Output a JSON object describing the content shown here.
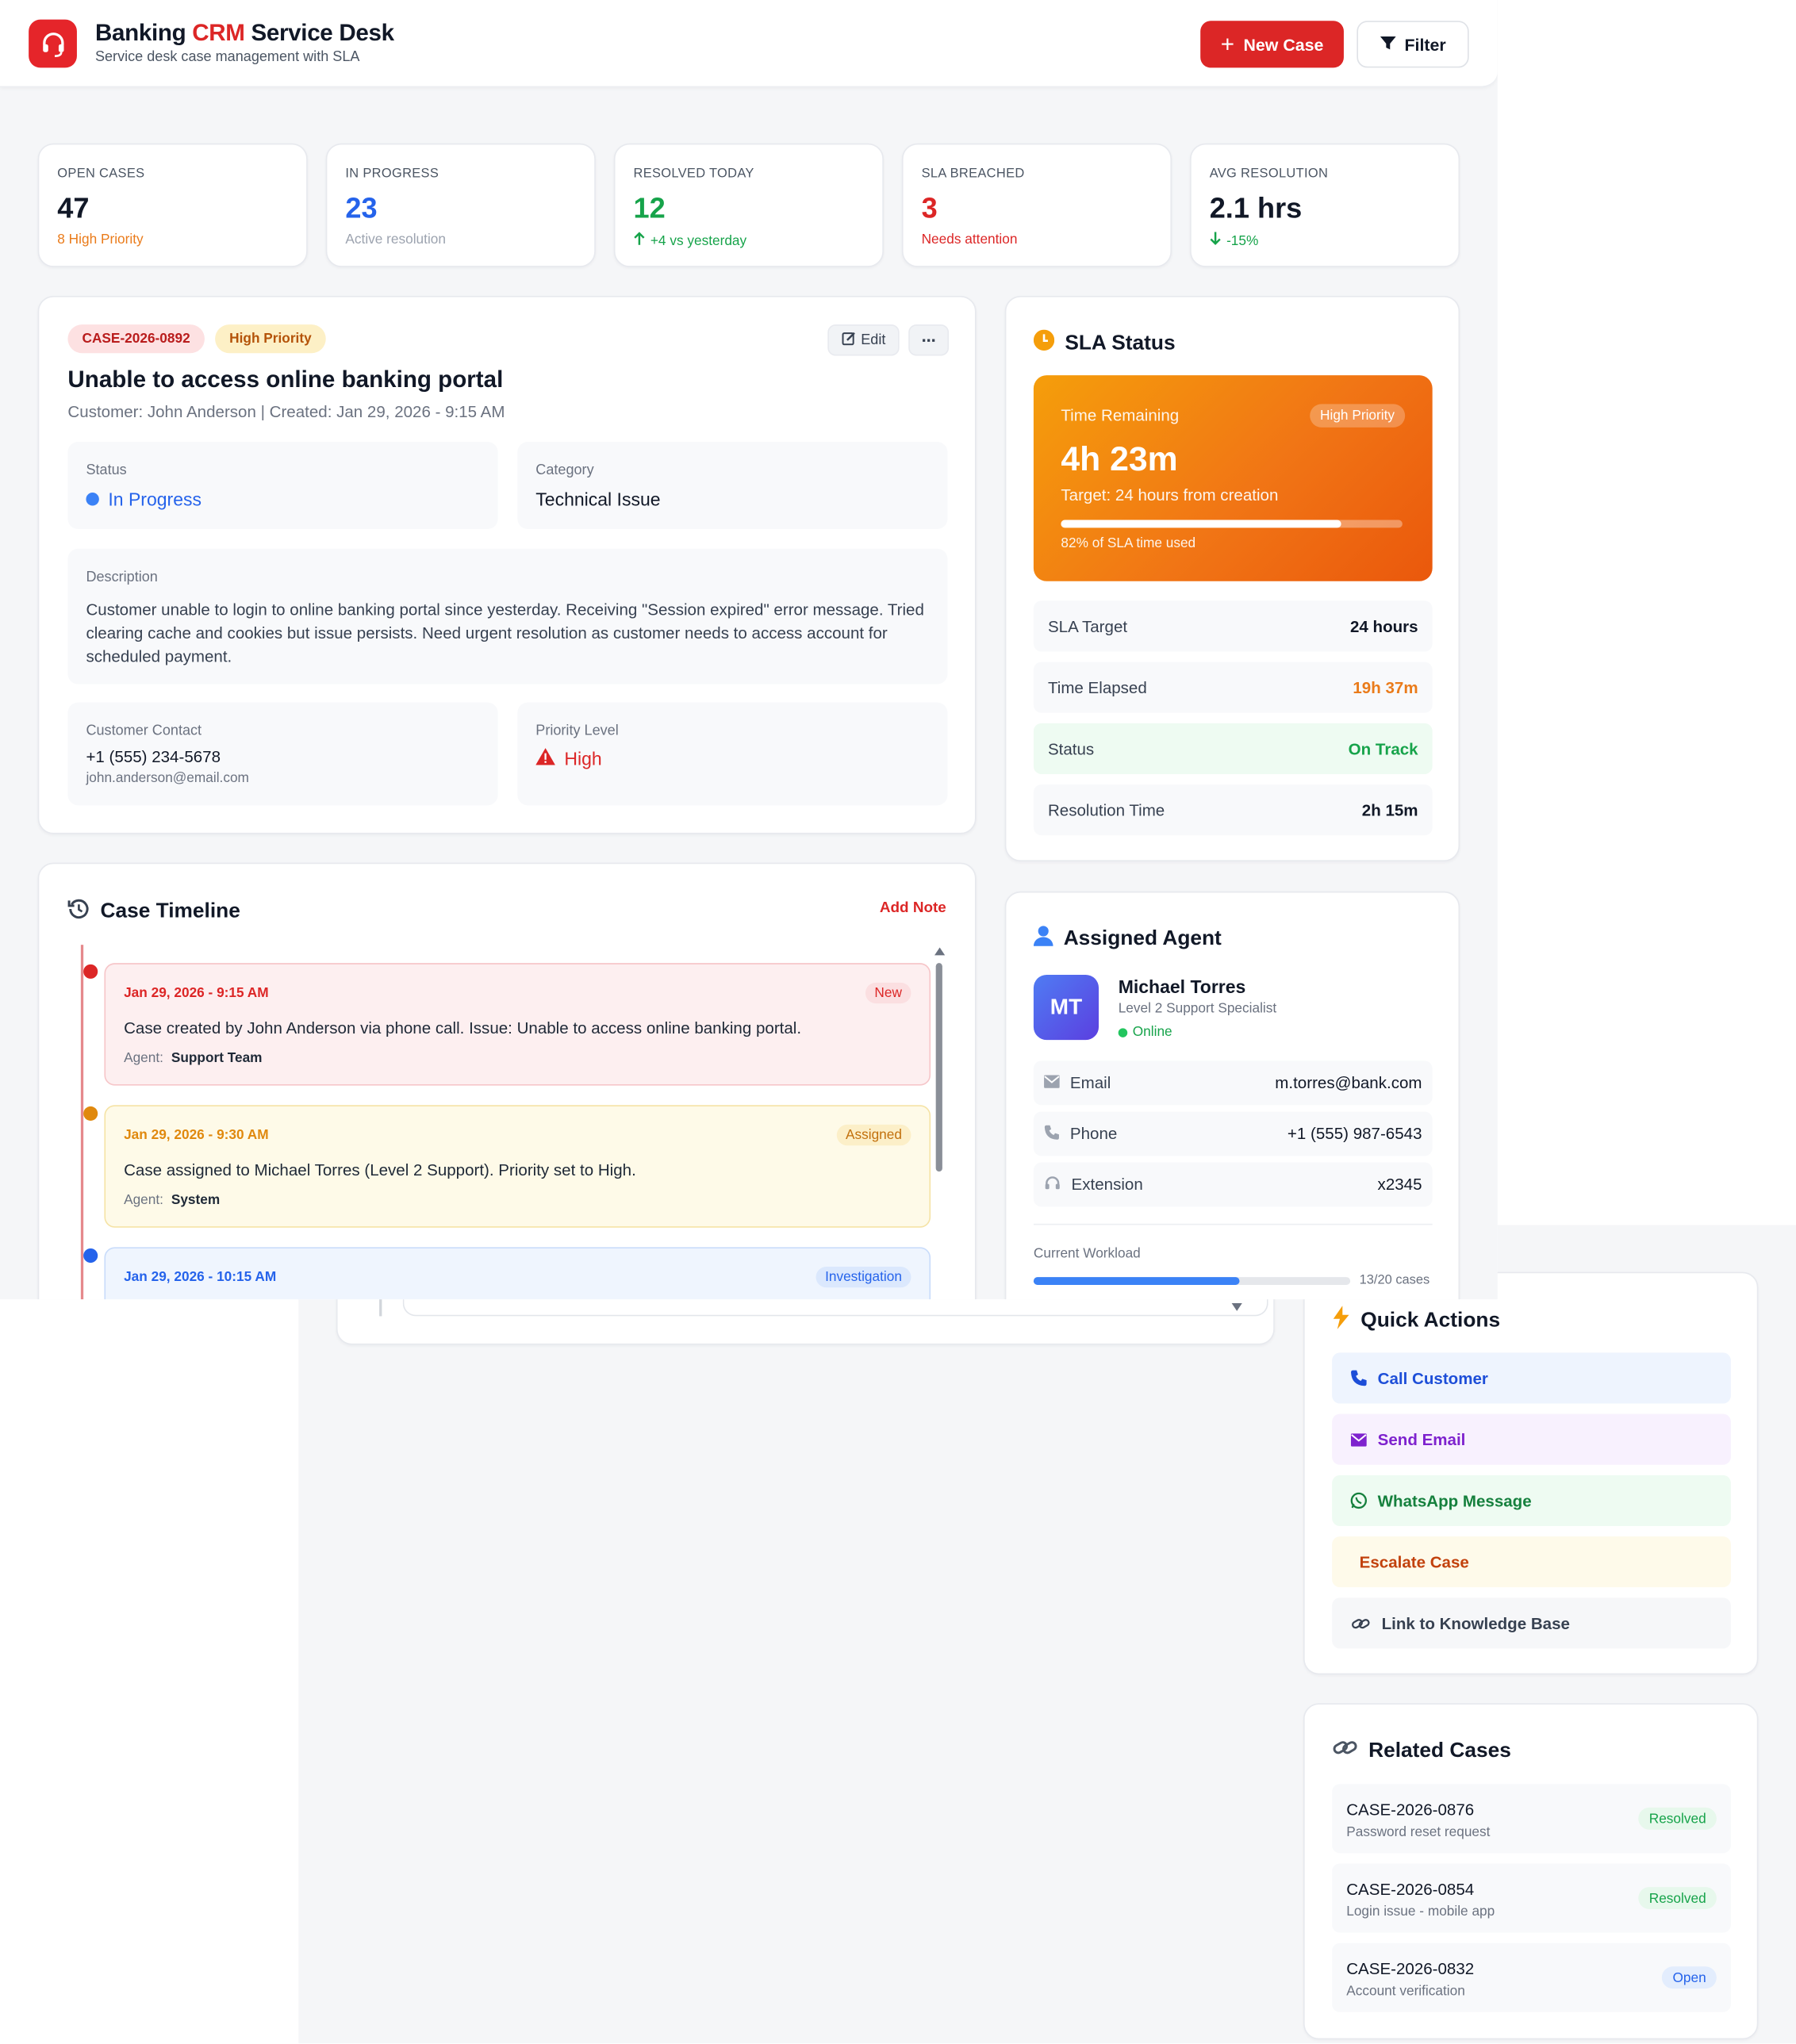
{
  "header": {
    "title_pre": "Banking ",
    "title_accent": "CRM",
    "title_post": " Service Desk",
    "subtitle": "Service desk case management with SLA",
    "new_case_label": "New Case",
    "filter_label": "Filter"
  },
  "kpis": [
    {
      "label": "Open Cases",
      "value": "47",
      "sub": "8 High Priority",
      "value_color": "#111827",
      "sub_color": "#ea7b1a"
    },
    {
      "label": "In Progress",
      "value": "23",
      "sub": "Active resolution",
      "value_color": "#2563eb",
      "sub_color": "#9ca3af"
    },
    {
      "label": "Resolved Today",
      "value": "12",
      "sub": "+4 vs yesterday",
      "value_color": "#16a34a",
      "sub_color": "#16a34a"
    },
    {
      "label": "SLA Breached",
      "value": "3",
      "sub": "Needs attention",
      "value_color": "#dc2626",
      "sub_color": "#dc2626"
    },
    {
      "label": "Avg Resolution",
      "value": "2.1 hrs",
      "sub": "-15%",
      "value_color": "#111827",
      "sub_color": "#16a34a"
    }
  ],
  "case": {
    "id": "CASE-2026-0892",
    "priority_badge": "High Priority",
    "edit_label": "Edit",
    "more_label": "⋯",
    "title": "Unable to access online banking portal",
    "meta": "Customer: John Anderson | Created: Jan 29, 2026 - 9:15 AM",
    "status_label": "Status",
    "status_value": "In Progress",
    "category_label": "Category",
    "category_value": "Technical Issue",
    "description_label": "Description",
    "description_line1": "Customer unable to login to online banking portal since yesterday. Receiving \"Session expired\" error message. Tried",
    "description_line2": "clearing cache and cookies but issue persists. Need urgent resolution as customer needs to access account for",
    "description_line3": "scheduled payment.",
    "contact_label": "Customer Contact",
    "contact_phone": "+1 (555) 234-5678",
    "contact_email": "john.anderson@email.com",
    "priority_label": "Priority Level",
    "priority_value": "High"
  },
  "sla": {
    "title": "SLA Status",
    "time_remaining_label": "Time Remaining",
    "priority_badge": "High Priority",
    "time_remaining": "4h 23m",
    "target_text": "Target: 24 hours from creation",
    "used_fraction": 0.82,
    "used_text": "82% of SLA time used",
    "rows": [
      {
        "label": "SLA Target",
        "value": "24 hours",
        "color": "#111827",
        "bg": "#f8f9fb"
      },
      {
        "label": "Time Elapsed",
        "value": "19h 37m",
        "color": "#ea7b1a",
        "bg": "#f8f9fb"
      },
      {
        "label": "Status",
        "value": "On Track",
        "color": "#16a34a",
        "bg": "#eefbf2"
      },
      {
        "label": "Resolution Time",
        "value": "2h 15m",
        "color": "#111827",
        "bg": "#f8f9fb"
      }
    ]
  },
  "timeline": {
    "title": "Case Timeline",
    "add_note_label": "Add Note",
    "agent_label": "Agent:",
    "items": [
      {
        "date": "Jan 29, 2026 - 9:15 AM",
        "tag": "New",
        "text": "Case created by John Anderson via phone call. Issue: Unable to access online banking portal.",
        "agent": "Support Team",
        "color": "#dc2626",
        "bg": "#fdeff0",
        "border": "#f6c6c9",
        "tag_bg": "#fbdfe1",
        "tag_color": "#dc2626"
      },
      {
        "date": "Jan 29, 2026 - 9:30 AM",
        "tag": "Assigned",
        "text": "Case assigned to Michael Torres (Level 2 Support). Priority set to High.",
        "agent": "System",
        "color": "#e0890e",
        "bg": "#fefae8",
        "border": "#f5e3a6",
        "tag_bg": "#fcefc8",
        "tag_color": "#c2700c"
      },
      {
        "date": "Jan 29, 2026 - 10:15 AM",
        "tag": "Investigation",
        "text": "",
        "agent": "",
        "color": "#2563eb",
        "bg": "#eff5fe",
        "border": "#c9dcfb",
        "tag_bg": "#dbe8fd",
        "tag_color": "#2563eb"
      }
    ]
  },
  "agent": {
    "title": "Assigned Agent",
    "initials": "MT",
    "name": "Michael Torres",
    "role": "Level 2 Support Specialist",
    "presence": "Online",
    "email_label": "Email",
    "email": "m.torres@bank.com",
    "phone_label": "Phone",
    "phone": "+1 (555) 987-6543",
    "ext_label": "Extension",
    "ext": "x2345",
    "workload_label": "Current Workload",
    "workload_fraction": 0.65,
    "workload_text": "13/20 cases"
  },
  "quick_actions": {
    "title": "Quick Actions",
    "items": [
      {
        "label": "Call Customer",
        "icon": "phone-icon",
        "color": "#1d4ed8",
        "bg": "#eef4fe"
      },
      {
        "label": "Send Email",
        "icon": "mail-icon",
        "color": "#7e22ce",
        "bg": "#f8f1fe"
      },
      {
        "label": "WhatsApp Message",
        "icon": "whatsapp-icon",
        "color": "#15803d",
        "bg": "#eefbf2"
      },
      {
        "label": "Escalate Case",
        "icon": "",
        "color": "#c2410c",
        "bg": "#fefaea"
      },
      {
        "label": "Link to Knowledge Base",
        "icon": "link-icon",
        "color": "#374151",
        "bg": "#f6f7f9"
      }
    ]
  },
  "related": {
    "title": "Related Cases",
    "items": [
      {
        "id": "CASE-2026-0876",
        "desc": "Password reset request",
        "status": "Resolved",
        "color": "#16a34a",
        "bg": "#e7f8ec"
      },
      {
        "id": "CASE-2026-0854",
        "desc": "Login issue - mobile app",
        "status": "Resolved",
        "color": "#16a34a",
        "bg": "#e7f8ec"
      },
      {
        "id": "CASE-2026-0832",
        "desc": "Account verification",
        "status": "Open",
        "color": "#2563eb",
        "bg": "#e3edfd"
      }
    ]
  }
}
